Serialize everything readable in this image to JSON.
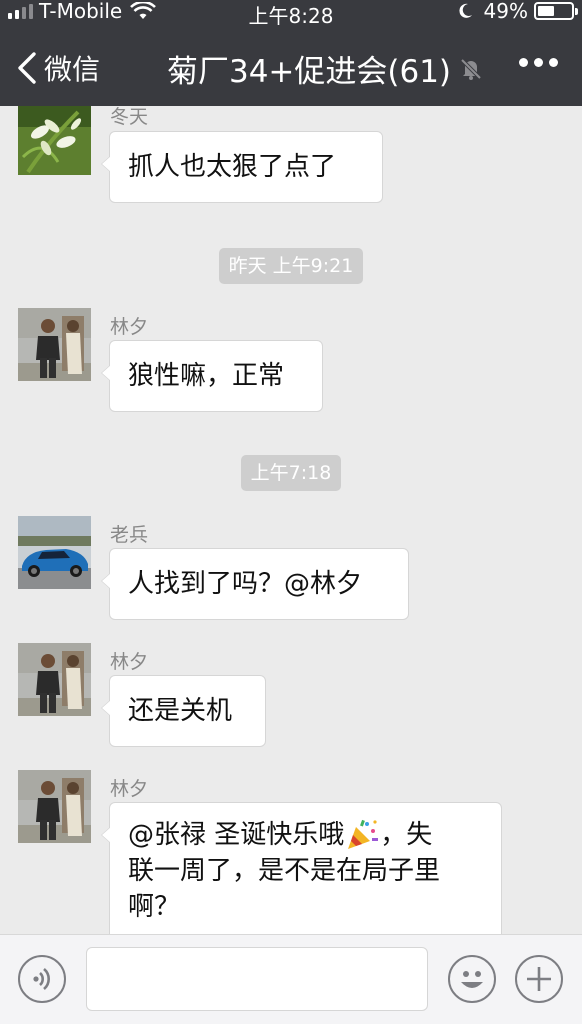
{
  "status_bar": {
    "carrier": "T-Mobile",
    "time": "上午8:28",
    "battery_text": "49%",
    "battery_level": 0.49
  },
  "nav": {
    "back_label": "微信",
    "title": "菊厂34+促进会(61)"
  },
  "messages": [
    {
      "sender": "冬天",
      "text": "抓人也太狠了点了",
      "avatar": "orchid-flower-photo"
    },
    {
      "timestamp": "昨天 上午9:21"
    },
    {
      "sender": "林夕",
      "text": "狼性嘛，正常",
      "avatar": "man-standing-photo"
    },
    {
      "timestamp": "上午7:18"
    },
    {
      "sender": "老兵",
      "text": "人找到了吗？@林夕",
      "avatar": "blue-sports-car-photo"
    },
    {
      "sender": "林夕",
      "text": "还是关机",
      "avatar": "man-standing-photo"
    },
    {
      "sender": "林夕",
      "lines": [
        "@张禄 圣诞快乐哦",
        "，失",
        "联一周了，是不是在局子里",
        "啊？"
      ],
      "emoji": "party-popper",
      "avatar": "man-standing-photo"
    }
  ],
  "icons": {
    "voice": "voice-toggle-icon",
    "emoji": "emoji-icon",
    "plus": "plus-icon",
    "mute": "mute-bell-icon"
  },
  "colors": {
    "header_bg": "#393a3f",
    "chat_bg": "#ebebeb",
    "bubble_bg": "#ffffff",
    "time_chip_bg": "#cecece"
  }
}
